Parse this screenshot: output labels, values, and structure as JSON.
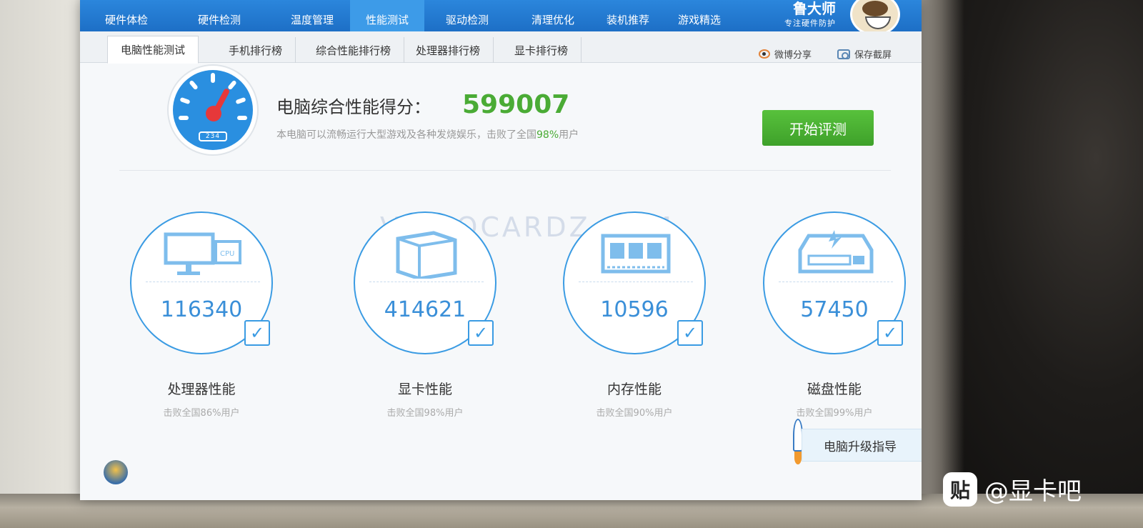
{
  "top_nav": {
    "items": [
      {
        "label": "硬件体检"
      },
      {
        "label": "硬件检测"
      },
      {
        "label": "温度管理"
      },
      {
        "label": "性能测试"
      },
      {
        "label": "驱动检测"
      },
      {
        "label": "清理优化"
      },
      {
        "label": "装机推荐"
      },
      {
        "label": "游戏精选"
      }
    ],
    "active": "性能测试",
    "brand_name": "鲁大师",
    "brand_slogan": "专注硬件防护"
  },
  "sub_tabs": {
    "items": [
      {
        "label": "电脑性能测试"
      },
      {
        "label": "手机排行榜"
      },
      {
        "label": "综合性能排行榜"
      },
      {
        "label": "处理器排行榜"
      },
      {
        "label": "显卡排行榜"
      }
    ],
    "active": "电脑性能测试"
  },
  "share": {
    "weibo_label": "微博分享",
    "screenshot_label": "保存截屏"
  },
  "summary": {
    "gauge_readout": "234",
    "title": "电脑综合性能得分：",
    "score": "599007",
    "desc_prefix": "本电脑可以流畅运行大型游戏及各种发烧娱乐，击败了全国",
    "desc_pct": "98%",
    "desc_suffix": "用户",
    "start_button": "开始评测"
  },
  "watermark": "VIDEOCARDZ.COM",
  "metrics": [
    {
      "score": "116340",
      "label": "处理器性能",
      "sub": "击败全国86%用户",
      "checked": true
    },
    {
      "score": "414621",
      "label": "显卡性能",
      "sub": "击败全国98%用户",
      "checked": true
    },
    {
      "score": "10596",
      "label": "内存性能",
      "sub": "击败全国90%用户",
      "checked": true
    },
    {
      "score": "57450",
      "label": "磁盘性能",
      "sub": "击败全国99%用户",
      "checked": true
    }
  ],
  "upgrade_label": "电脑升级指导",
  "tieba": {
    "logo": "贴",
    "handle": "@显卡吧"
  },
  "colors": {
    "nav_blue": "#1d6fc6",
    "score_green": "#4aab35",
    "metric_blue": "#3a9be3",
    "button_green": "#3ea12a"
  }
}
